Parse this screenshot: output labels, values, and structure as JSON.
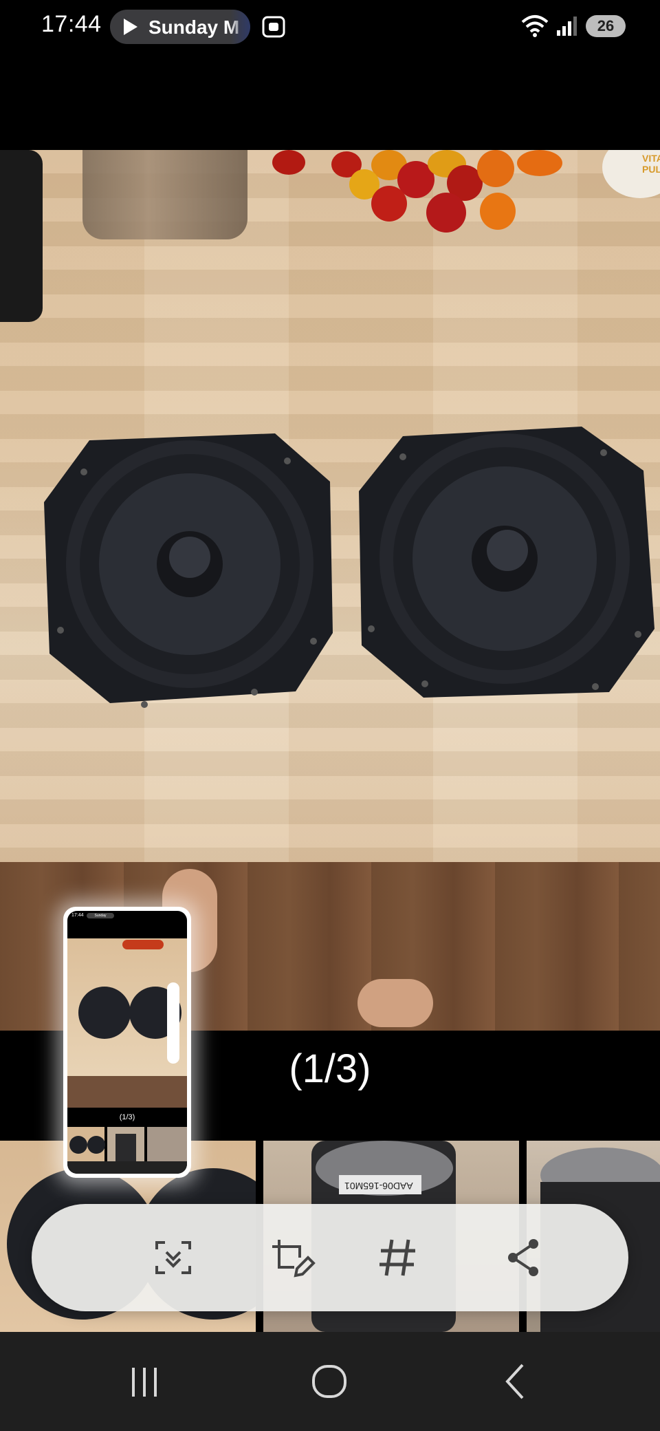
{
  "status_bar": {
    "time": "17:44",
    "media_title": "Sunday M",
    "battery": "26",
    "icons": [
      "play-icon",
      "screenshot-capture-icon",
      "wifi-icon",
      "signal-icon",
      "battery-icon"
    ]
  },
  "viewer": {
    "counter": "(1/3)",
    "thumbnails": [
      {
        "label": "thumbnail-1"
      },
      {
        "label": "AAD06-165M01"
      },
      {
        "label": "thumbnail-3"
      }
    ],
    "photo_text": "VITA PULS"
  },
  "toolbar": {
    "actions": [
      {
        "name": "scroll-capture",
        "icon": "scroll-capture-icon"
      },
      {
        "name": "edit",
        "icon": "crop-edit-icon"
      },
      {
        "name": "tags",
        "icon": "hashtag-icon"
      },
      {
        "name": "share",
        "icon": "share-icon"
      }
    ]
  },
  "preview": {
    "time": "17:44",
    "pill": "Sunday",
    "counter": "(1/3)"
  },
  "navbar": {
    "buttons": [
      "recent-apps",
      "home",
      "back"
    ]
  },
  "colors": {
    "toolbar_bg": "#f0f0ee",
    "navbar_bg": "#1f1f1f",
    "battery_bg": "#bdbdbd"
  }
}
